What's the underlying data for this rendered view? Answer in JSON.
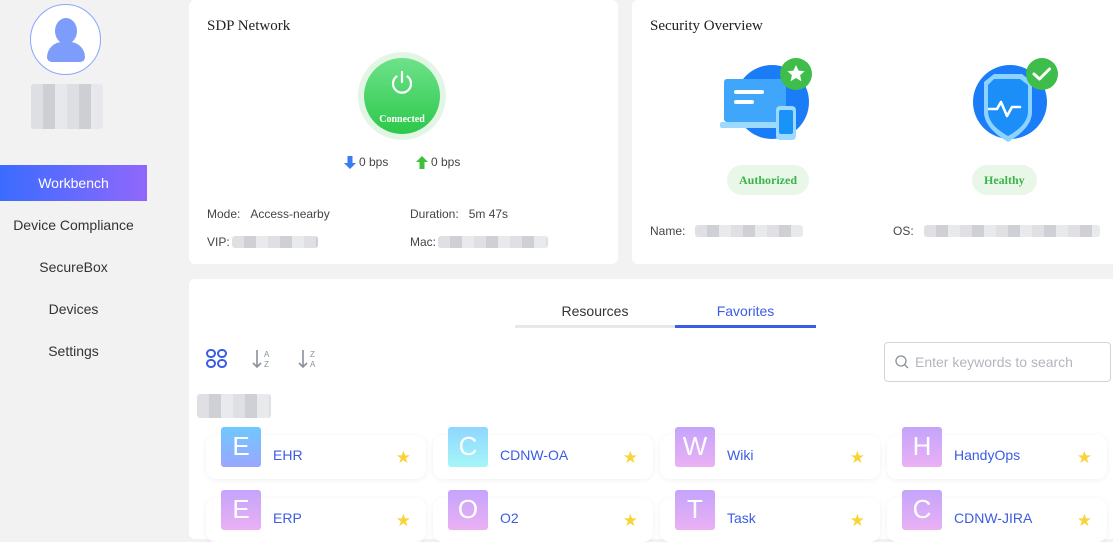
{
  "sidebar": {
    "items": [
      {
        "label": "Workbench",
        "active": true
      },
      {
        "label": "Device Compliance",
        "active": false
      },
      {
        "label": "SecureBox",
        "active": false
      },
      {
        "label": "Devices",
        "active": false
      },
      {
        "label": "Settings",
        "active": false
      }
    ]
  },
  "sdp": {
    "title": "SDP Network",
    "status": "Connected",
    "download": "0 bps",
    "upload": "0 bps",
    "mode_label": "Mode:",
    "mode_value": "Access-nearby",
    "duration_label": "Duration:",
    "duration_value": "5m 47s",
    "vip_label": "VIP:",
    "mac_label": "Mac:"
  },
  "security": {
    "title": "Security Overview",
    "auth_status": "Authorized",
    "health_status": "Healthy",
    "name_label": "Name:",
    "os_label": "OS:"
  },
  "resources": {
    "tabs": [
      {
        "label": "Resources",
        "active": false
      },
      {
        "label": "Favorites",
        "active": true
      }
    ],
    "search_placeholder": "Enter keywords to search",
    "apps": [
      {
        "letter": "E",
        "name": "EHR",
        "gradient": [
          "#6ec8ff",
          "#9aa6ff"
        ]
      },
      {
        "letter": "C",
        "name": "CDNW-OA",
        "gradient": [
          "#8fd6ff",
          "#a4f6f8"
        ]
      },
      {
        "letter": "W",
        "name": "Wiki",
        "gradient": [
          "#c4a4fb",
          "#eab0f4"
        ]
      },
      {
        "letter": "H",
        "name": "HandyOps",
        "gradient": [
          "#c4a4fb",
          "#eab0f4"
        ]
      },
      {
        "letter": "E",
        "name": "ERP",
        "gradient": [
          "#c4a4fb",
          "#eab0f4"
        ]
      },
      {
        "letter": "O",
        "name": "O2",
        "gradient": [
          "#c4a4fb",
          "#eab0f4"
        ]
      },
      {
        "letter": "T",
        "name": "Task",
        "gradient": [
          "#c4a4fb",
          "#eab0f4"
        ]
      },
      {
        "letter": "C",
        "name": "CDNW-JIRA",
        "gradient": [
          "#c4a4fb",
          "#eab0f4"
        ]
      }
    ]
  },
  "colors": {
    "accent": "#3b5ce6",
    "connected_green": "#2cc84b",
    "favorite_star": "#f8d43a"
  }
}
